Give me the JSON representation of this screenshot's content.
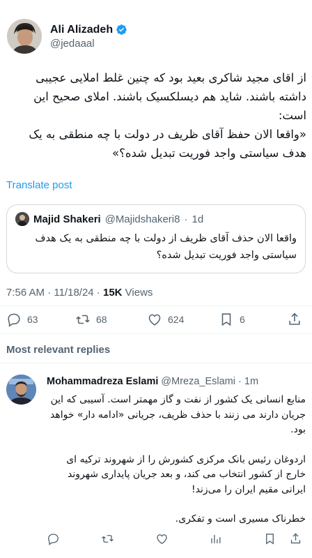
{
  "author": {
    "name": "Ali Alizadeh",
    "handle": "@jedaaal"
  },
  "tweet": {
    "paragraph": "از اقای مجید شاکری بعید بود که چنین غلط املایی عجیبی داشته باشند. شاید هم دیسلکسیک باشند. املای صحیح این است:",
    "quote_line": "«واقعا الان حفظ آقای ظریف در دولت با چه منطقی به یک هدف سیاستی واجد فوریت تبدیل شده؟»"
  },
  "translate_label": "Translate post",
  "quoted": {
    "name": "Majid Shakeri",
    "handle": "@Majidshakeri8",
    "dot": "·",
    "time": "1d",
    "text": "واقعا الان حذف آقای ظریف از دولت با چه منطقی به یک هدف سیاستی واجد فوریت تبدیل شده؟"
  },
  "meta": {
    "time_date": "7:56 AM · 11/18/24 · ",
    "views_count": "15K",
    "views_label": " Views"
  },
  "stats": {
    "replies": "63",
    "reposts": "68",
    "likes": "624",
    "bookmarks": "6"
  },
  "replies_header": "Most relevant replies",
  "reply": {
    "name": "Mohammadreza Eslami",
    "handle": "@Mreza_Eslami",
    "dot": "·",
    "time": "1m",
    "p1": "منابع انسانی یک کشور از نفت و گاز مهمتر است. آسیبی که این جریان دارند می زنند با حذف ظریف، جریانی «ادامه دار» خواهد بود.",
    "p2": "اردوغان رئیس بانک مرکزی کشورش را از شهروند ترکیه ای خارج از کشور انتخاب می کند، و بعد جریان پایداری شهروند ایرانی مقیم ایران را می‌زند!",
    "p3": "خطرناک مسیری است و تفکری."
  },
  "colors": {
    "accent": "#1d9bf0",
    "secondary_text": "#536471",
    "border": "#cfd9de"
  },
  "icons": [
    "verified-badge-icon",
    "reply-icon",
    "repost-icon",
    "like-icon",
    "bookmark-icon",
    "views-icon"
  ]
}
